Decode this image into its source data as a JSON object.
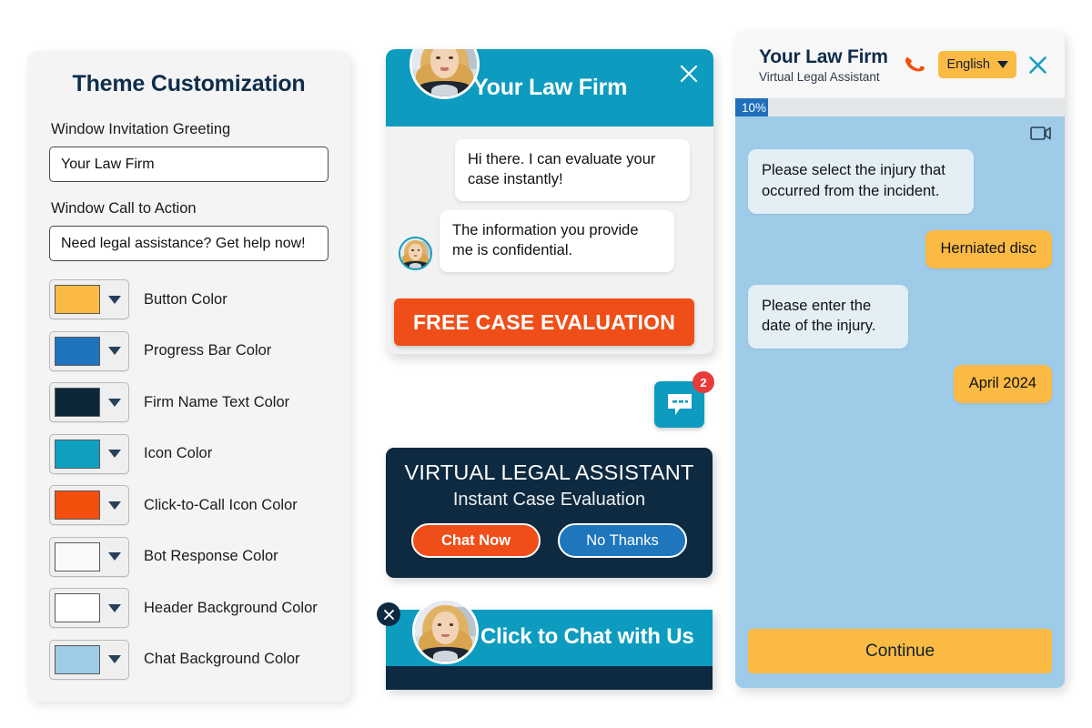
{
  "theme_panel": {
    "title": "Theme Customization",
    "fields": [
      {
        "label": "Window Invitation Greeting",
        "value": "Your Law Firm"
      },
      {
        "label": "Window Call to Action",
        "value": "Need legal assistance? Get help now!"
      }
    ],
    "swatches": [
      {
        "label": "Button Color",
        "color": "#fbba43"
      },
      {
        "label": "Progress Bar Color",
        "color": "#1f74bd"
      },
      {
        "label": "Firm Name Text Color",
        "color": "#0c2638"
      },
      {
        "label": "Icon Color",
        "color": "#0fa0c1"
      },
      {
        "label": "Click-to-Call Icon Color",
        "color": "#f44e0d"
      },
      {
        "label": "Bot Response Color",
        "color": "#fafafa"
      },
      {
        "label": "Header Background Color",
        "color": "#ffffff"
      },
      {
        "label": "Chat Background Color",
        "color": "#9ecbe8"
      }
    ],
    "caret_icon": "chevron-down-icon"
  },
  "widget": {
    "title": "Your Law Firm",
    "close_icon": "close-icon",
    "avatar_icon": "agent-avatar",
    "messages": [
      {
        "from": "bot",
        "text": "Hi there. I can evaluate your case instantly!"
      },
      {
        "from": "bot",
        "text": "The information you provide me is confidential."
      }
    ],
    "cta_label": "FREE CASE EVALUATION",
    "header_color": "#0d9cc0",
    "cta_color": "#f04e18"
  },
  "launcher": {
    "icon": "chat-bubble-icon",
    "badge_count": "2",
    "badge_color": "#e83b3b",
    "bg_color": "#0d9cc0"
  },
  "promo": {
    "heading": "VIRTUAL LEGAL ASSISTANT",
    "subheading": "Instant Case Evaluation",
    "primary_button": "Chat Now",
    "secondary_button": "No Thanks",
    "bg_color": "#0d2a41"
  },
  "click_to_chat": {
    "text": "Click to Chat with Us",
    "close_icon": "close-circle-icon",
    "avatar_icon": "agent-avatar",
    "bar_color": "#0d9cc0",
    "footer_color": "#0d2a41"
  },
  "assistant": {
    "firm_name": "Your Law Firm",
    "subtitle": "Virtual Legal Assistant",
    "phone_icon": "phone-icon",
    "language": "English",
    "language_caret_icon": "chevron-down-icon",
    "close_icon": "close-icon",
    "progress_label": "10%",
    "progress_percent": 10,
    "video_icon": "video-camera-icon",
    "messages": [
      {
        "from": "bot",
        "text": "Please select the injury that occurred from the incident."
      },
      {
        "from": "user",
        "text": "Herniated disc"
      },
      {
        "from": "bot",
        "text": "Please enter the date of the injury."
      },
      {
        "from": "user",
        "text": "April 2024"
      }
    ],
    "continue_label": "Continue",
    "chat_bg_color": "#9ecbe8",
    "user_bubble_color": "#fbba43",
    "bot_bubble_color": "#e3eef5"
  }
}
